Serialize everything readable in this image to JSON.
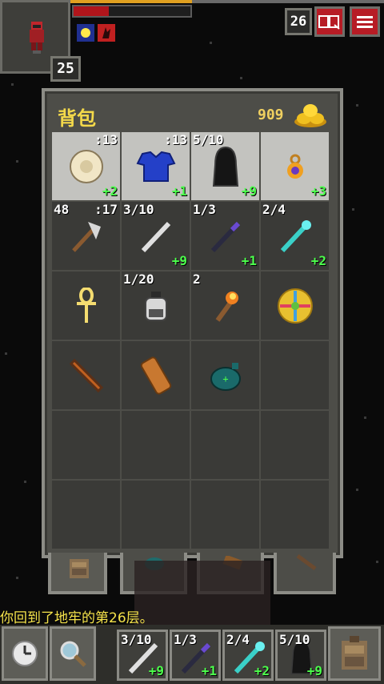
{
  "status": {
    "hero_level": "25",
    "depth": "26",
    "hp_fraction": 0.3,
    "xp_fraction": 0.5,
    "buffs": [
      "light-buff-icon",
      "burning-buff-icon"
    ]
  },
  "top_buttons": {
    "journal_icon": "journal-icon",
    "menu_icon": "menu-icon"
  },
  "backpack": {
    "title": "背包",
    "gold": "909",
    "slots": [
      {
        "name": "armband-round-shield",
        "tl": "",
        "tr": ":13",
        "br": "+2",
        "equipped": true
      },
      {
        "name": "blue-plate-armor",
        "tl": "",
        "tr": ":13",
        "br": "+1",
        "equipped": true
      },
      {
        "name": "black-cloak-artifact",
        "tl": "5/10",
        "tr": "",
        "br": "+9",
        "equipped": true
      },
      {
        "name": "amulet-ring",
        "tl": "",
        "tr": "",
        "br": "+3",
        "equipped": true
      },
      {
        "name": "throwing-axe",
        "tl": "48",
        "tr": ":17",
        "br": "",
        "equipped": false
      },
      {
        "name": "silver-wand",
        "tl": "3/10",
        "tr": "",
        "br": "+9",
        "equipped": false
      },
      {
        "name": "dark-wand",
        "tl": "1/3",
        "tr": "",
        "br": "+1",
        "equipped": false
      },
      {
        "name": "cyan-wand",
        "tl": "2/4",
        "tr": "",
        "br": "+2",
        "equipped": false
      },
      {
        "name": "ankh",
        "tl": "",
        "tr": "",
        "br": "",
        "equipped": false
      },
      {
        "name": "dew-vial",
        "tl": "1/20",
        "tr": "",
        "br": "",
        "equipped": false
      },
      {
        "name": "torch",
        "tl": "2",
        "tr": "",
        "br": "",
        "equipped": false
      },
      {
        "name": "rune-compass",
        "tl": "",
        "tr": "",
        "br": "",
        "equipped": false
      },
      {
        "name": "sword-scabbard",
        "tl": "",
        "tr": "",
        "br": "",
        "equipped": false
      },
      {
        "name": "scroll-holder",
        "tl": "",
        "tr": "",
        "br": "",
        "equipped": false
      },
      {
        "name": "seed-pouch",
        "tl": "",
        "tr": "",
        "br": "",
        "equipped": false
      },
      {
        "name": "empty",
        "tl": "",
        "tr": "",
        "br": "",
        "equipped": false
      },
      {
        "name": "empty",
        "tl": "",
        "tr": "",
        "br": "",
        "equipped": false
      },
      {
        "name": "empty",
        "tl": "",
        "tr": "",
        "br": "",
        "equipped": false
      },
      {
        "name": "empty",
        "tl": "",
        "tr": "",
        "br": "",
        "equipped": false
      },
      {
        "name": "empty",
        "tl": "",
        "tr": "",
        "br": "",
        "equipped": false
      },
      {
        "name": "empty",
        "tl": "",
        "tr": "",
        "br": "",
        "equipped": false
      },
      {
        "name": "empty",
        "tl": "",
        "tr": "",
        "br": "",
        "equipped": false
      },
      {
        "name": "empty",
        "tl": "",
        "tr": "",
        "br": "",
        "equipped": false
      },
      {
        "name": "empty",
        "tl": "",
        "tr": "",
        "br": "",
        "equipped": false
      }
    ],
    "tabs": [
      "backpack-tab-icon",
      "seed-pouch-tab-icon",
      "scroll-holder-tab-icon",
      "wand-holster-tab-icon"
    ]
  },
  "message": "你回到了地牢的第26层。",
  "toolbar": {
    "wait_icon": "clock-icon",
    "search_icon": "magnifier-icon",
    "quickslots": [
      {
        "name": "silver-wand",
        "tl": "3/10",
        "br": "+9"
      },
      {
        "name": "dark-wand",
        "tl": "1/3",
        "br": "+1"
      },
      {
        "name": "cyan-wand",
        "tl": "2/4",
        "br": "+2"
      },
      {
        "name": "black-cloak-artifact",
        "tl": "5/10",
        "br": "+9"
      }
    ],
    "backpack_icon": "backpack-icon"
  },
  "colors": {
    "title_yellow": "#f4d94a",
    "upgrade_green": "#4cff4c",
    "hp_red": "#b0151b",
    "button_red": "#b71c25"
  }
}
